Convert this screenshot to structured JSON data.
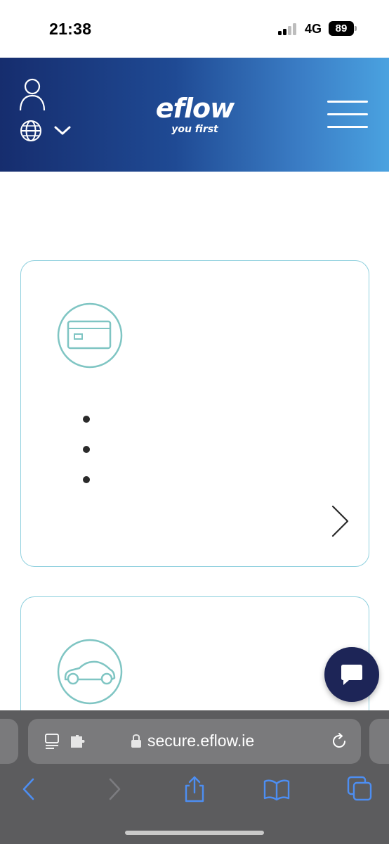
{
  "status_bar": {
    "time": "21:38",
    "network": "4G",
    "battery": "89",
    "signal_bars_filled": 2,
    "signal_bars_total": 4
  },
  "header": {
    "logo_text": "eflow",
    "logo_tagline": "you first",
    "icons": {
      "account": "user-icon",
      "language": "globe-icon",
      "language_dropdown": "chevron-down-icon",
      "menu": "hamburger-menu-icon"
    },
    "gradient_colors": [
      "#162d6e",
      "#4aa2e0"
    ]
  },
  "cards": [
    {
      "icon": "credit-card-icon",
      "bullet_count": 3,
      "arrow": "chevron-right-icon"
    },
    {
      "icon": "car-icon"
    }
  ],
  "chat": {
    "icon": "chat-bubble-icon",
    "color": "#1d2557"
  },
  "browser": {
    "url": "secure.eflow.ie",
    "icons": {
      "reader": "reader-mode-icon",
      "extensions": "extension-icon",
      "lock": "lock-icon",
      "reload": "reload-icon"
    },
    "toolbar": [
      "back-icon",
      "forward-icon",
      "share-icon",
      "bookmarks-icon",
      "tabs-icon"
    ]
  },
  "colors": {
    "accent_teal": "#7fc5c3",
    "card_border": "#8fd0de",
    "safari_blue": "#4d8ef2"
  }
}
